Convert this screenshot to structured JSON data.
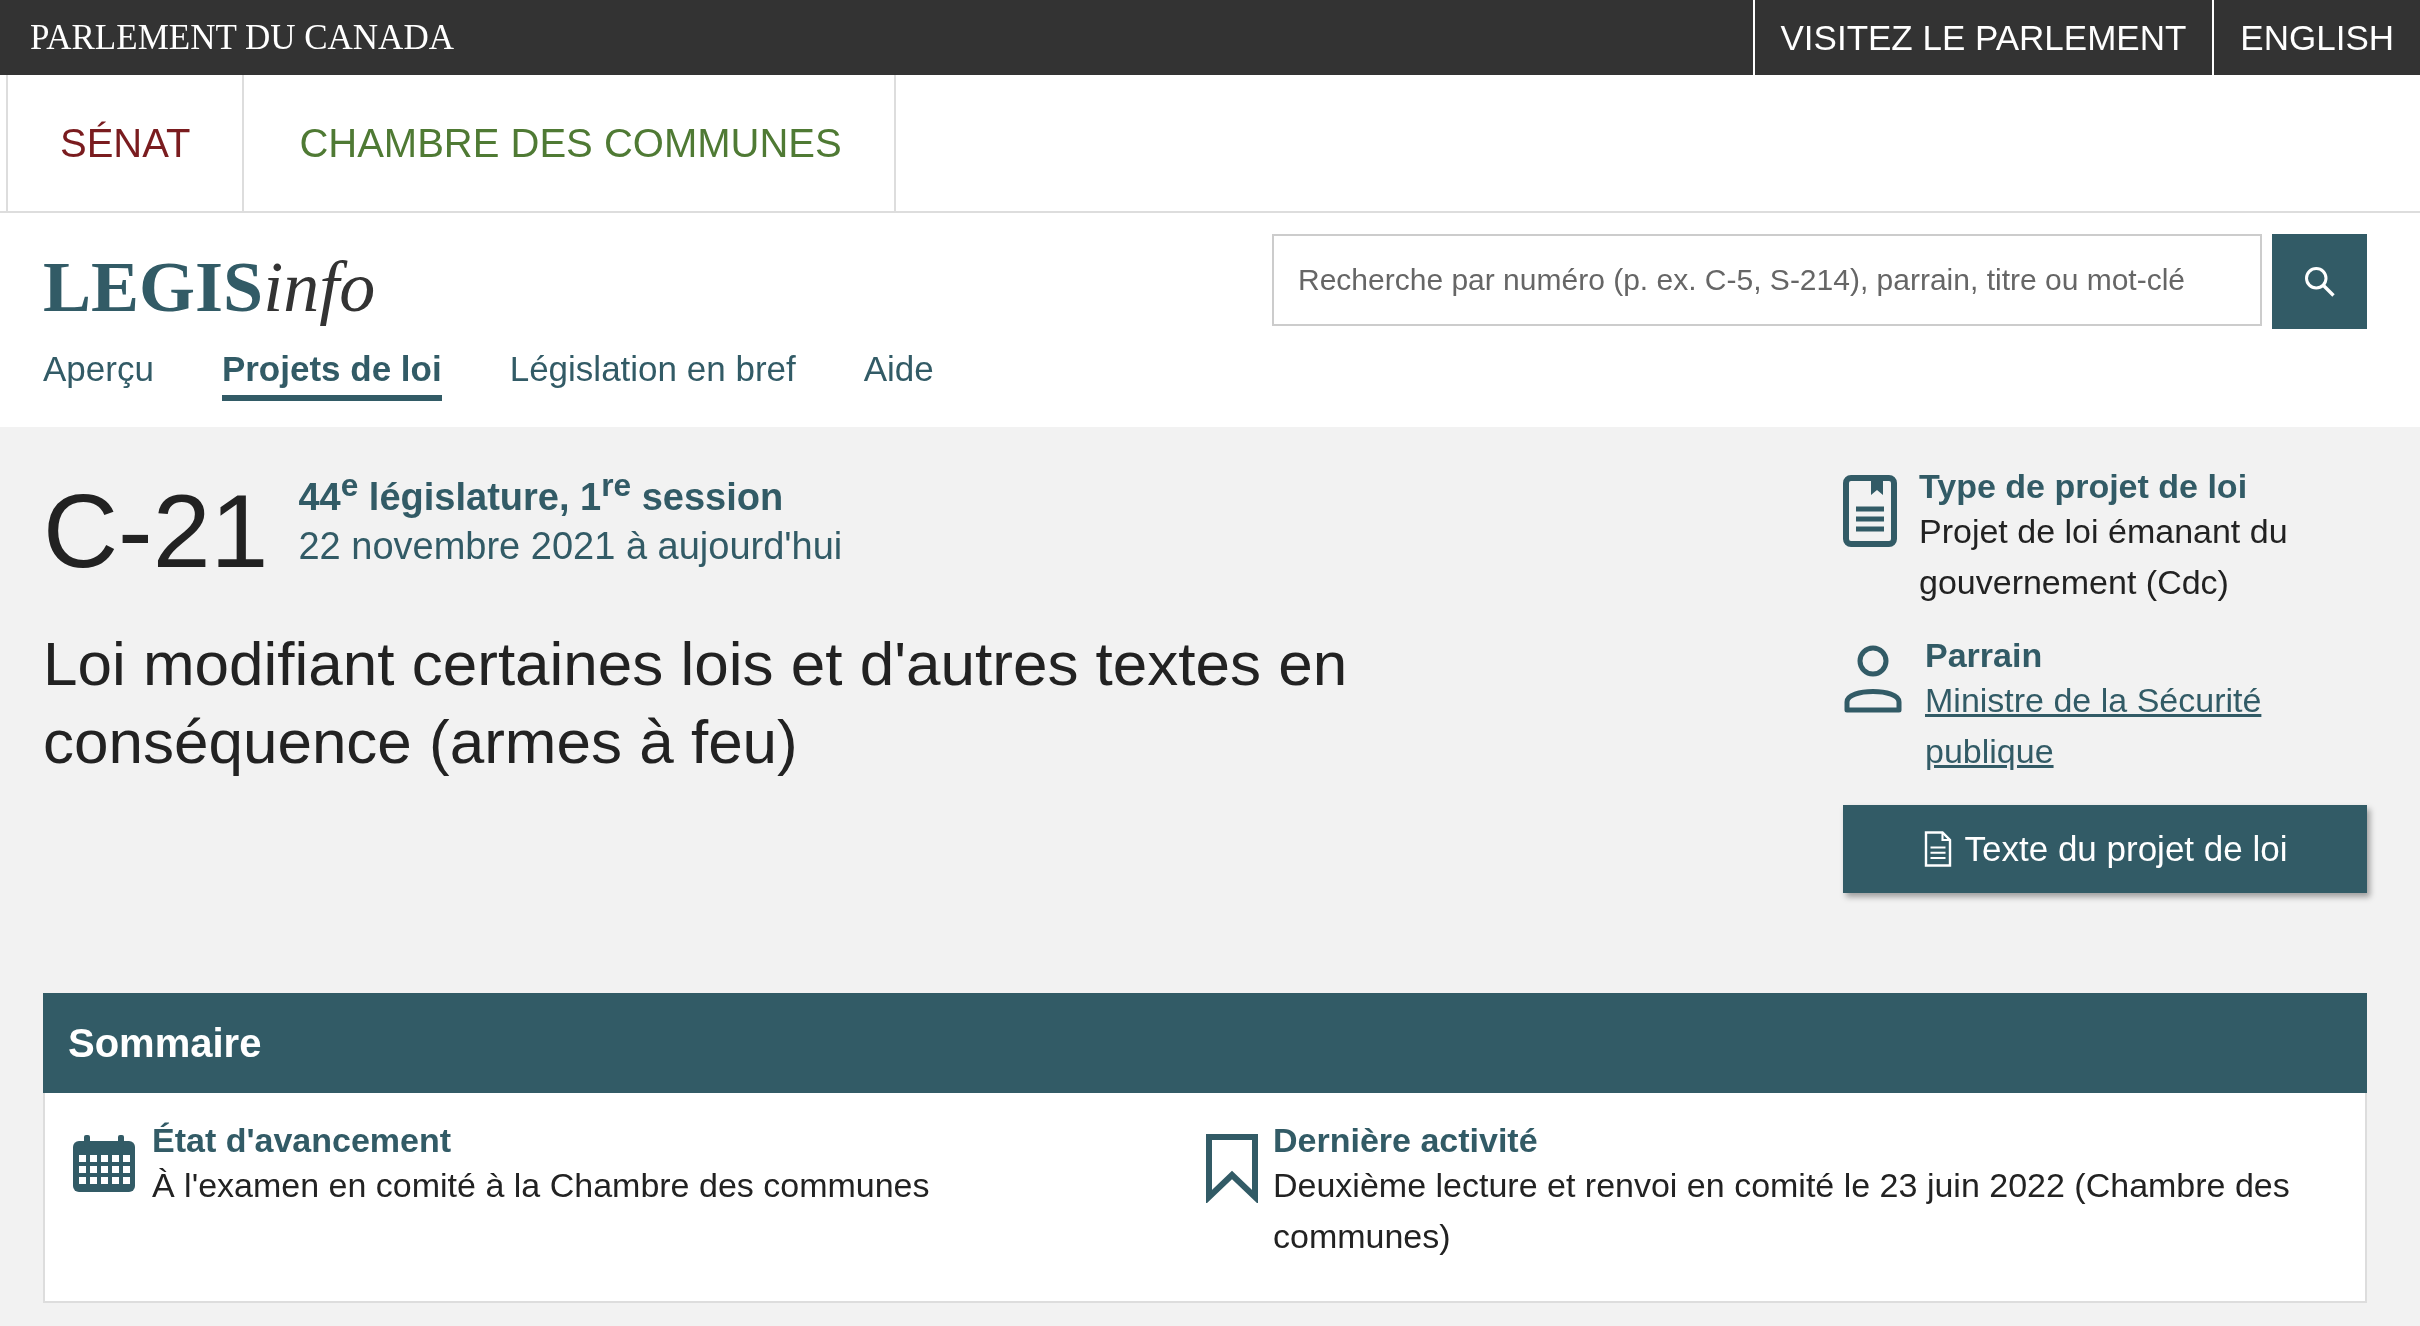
{
  "top_bar": {
    "title": "PARLEMENT DU CANADA",
    "links": [
      "VISITEZ LE PARLEMENT",
      "ENGLISH"
    ]
  },
  "chambers": [
    {
      "label": "SÉNAT",
      "color": "#7a1c1f"
    },
    {
      "label": "CHAMBRE DES COMMUNES",
      "color": "#4f7a34"
    }
  ],
  "logo": {
    "bold": "LEGIS",
    "italic": "info"
  },
  "search": {
    "placeholder": "Recherche par numéro (p. ex. C-5, S-214), parrain, titre ou mot-clé"
  },
  "nav": [
    {
      "label": "Aperçu",
      "selected": false
    },
    {
      "label": "Projets de loi",
      "selected": true
    },
    {
      "label": "Législation en bref",
      "selected": false
    },
    {
      "label": "Aide",
      "selected": false
    }
  ],
  "bill": {
    "number": "C-21",
    "session": "44$^{e}$ législature, 1$^{re}$ session",
    "dates": "22 novembre 2021 à aujourd'hui",
    "title": "Loi modifiant certaines lois et d'autres textes en conséquence (armes à feu)"
  },
  "details": [
    {
      "kind": "type",
      "label": "Type de projet de loi",
      "value": "Projet de loi émanant du gouvernement (Cdc)"
    },
    {
      "kind": "sponsor",
      "label": "Parrain",
      "link": "Ministre de la Sécurité publique"
    }
  ],
  "text_button": "Texte du projet de loi",
  "summary": {
    "title": "Sommaire",
    "items": [
      {
        "kind": "status",
        "label": "État d'avancement",
        "value": "À l'examen en comité à la Chambre des communes"
      },
      {
        "kind": "activity",
        "label": "Dernière activité",
        "value": "Deuxième lecture et renvoi en comité le 23 juin 2022 (Chambre des communes)"
      }
    ]
  }
}
